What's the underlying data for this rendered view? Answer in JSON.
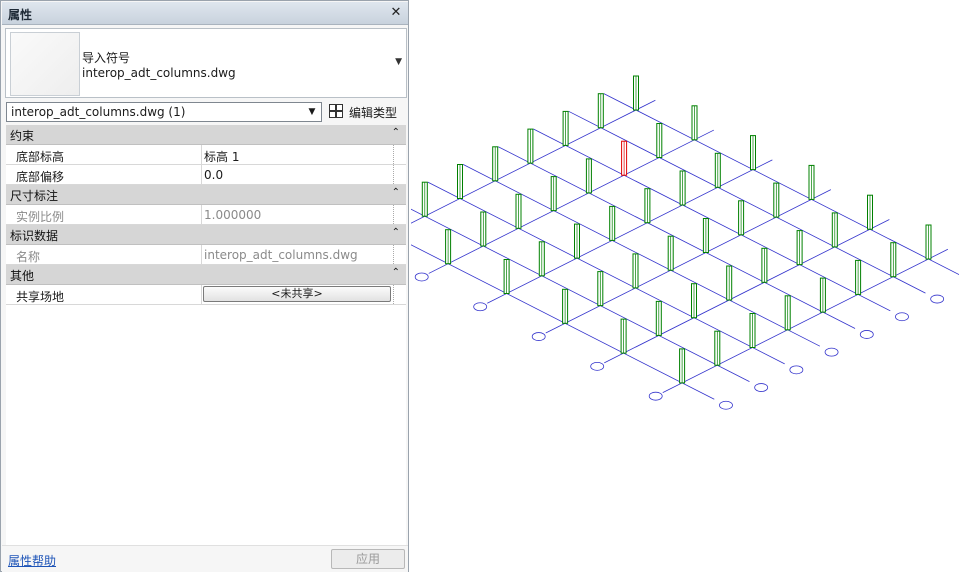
{
  "palette": {
    "title": "属性",
    "close_symbol": "✕",
    "type_family_label": "导入符号",
    "type_name": "interop_adt_columns.dwg",
    "instance_selector_value": "interop_adt_columns.dwg (1)",
    "edit_type_label": "编辑类型",
    "categories": {
      "constraints": "约束",
      "dimensions": "尺寸标注",
      "identity": "标识数据",
      "other": "其他"
    },
    "properties": {
      "base_level": {
        "name": "底部标高",
        "value": "标高 1"
      },
      "base_offset": {
        "name": "底部偏移",
        "value": "0.0"
      },
      "instance_scale": {
        "name": "实例比例",
        "value": "1.000000"
      },
      "name": {
        "name": "名称",
        "value": "interop_adt_columns.dwg"
      },
      "shared_site": {
        "name": "共享场地",
        "value": "<未共享>"
      }
    },
    "help_link": "属性帮助",
    "apply_label": "应用"
  },
  "view": {
    "grid_line_color": "#3333cc",
    "column_color": "#008000",
    "selected_column_color": "#e00000",
    "bubble_color": "#3333cc"
  }
}
